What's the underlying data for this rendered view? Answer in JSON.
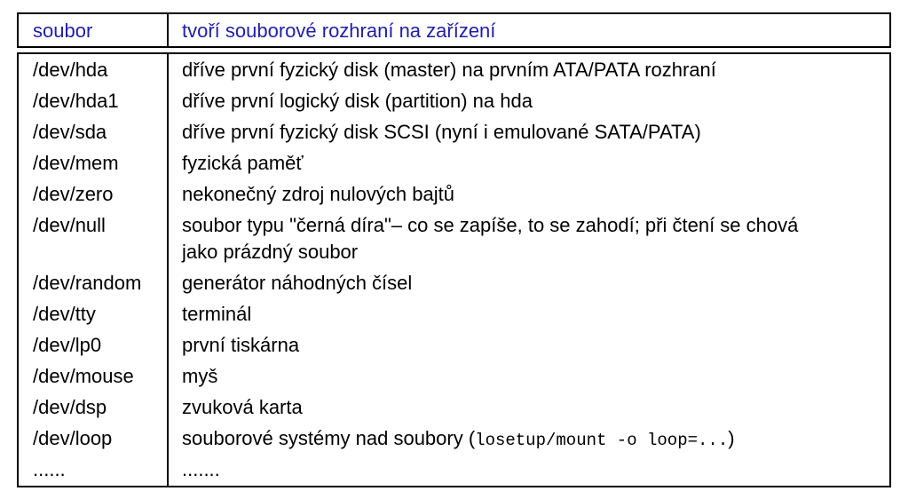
{
  "header": {
    "col1": "soubor",
    "col2": "tvoří souborové rozhraní na zařízení"
  },
  "rows": [
    {
      "file": "/dev/hda",
      "desc": "dříve první fyzický disk (master) na prvním ATA/PATA rozhraní"
    },
    {
      "file": "/dev/hda1",
      "desc": "dříve první logický disk (partition) na hda"
    },
    {
      "file": "/dev/sda",
      "desc": "dříve první fyzický disk SCSI (nyní i emulované SATA/PATA)"
    },
    {
      "file": "/dev/mem",
      "desc": "fyzická paměť"
    },
    {
      "file": "/dev/zero",
      "desc": "nekonečný zdroj nulových bajtů"
    },
    {
      "file": "/dev/null",
      "desc": "soubor typu \"černá díra\"– co se zapíše, to se zahodí; při čtení se chová",
      "desc_line2": "jako prázdný soubor"
    },
    {
      "file": "/dev/random",
      "desc": "generátor náhodných čísel"
    },
    {
      "file": "/dev/tty",
      "desc": "terminál"
    },
    {
      "file": "/dev/lp0",
      "desc": "první tiskárna"
    },
    {
      "file": "/dev/mouse",
      "desc": "myš"
    },
    {
      "file": "/dev/dsp",
      "desc": "zvuková karta"
    },
    {
      "file": "/dev/loop",
      "desc": "souborové systémy nad soubory (",
      "desc_code": "losetup/mount -o loop=...",
      "desc_tail": ")"
    },
    {
      "file": "......",
      "desc": "......."
    }
  ],
  "colors": {
    "header_text": "#1f1fa8",
    "border": "#000000"
  }
}
